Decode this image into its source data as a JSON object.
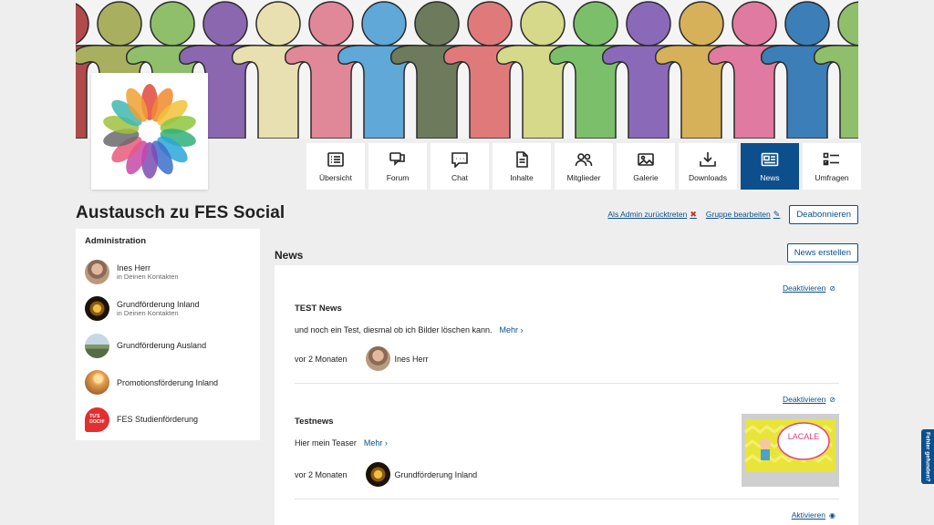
{
  "tabs": [
    {
      "label": "Übersicht",
      "icon": "list-icon"
    },
    {
      "label": "Forum",
      "icon": "chat-bubbles-icon"
    },
    {
      "label": "Chat",
      "icon": "chat-icon"
    },
    {
      "label": "Inhalte",
      "icon": "document-icon"
    },
    {
      "label": "Mitglieder",
      "icon": "members-icon"
    },
    {
      "label": "Galerie",
      "icon": "image-icon"
    },
    {
      "label": "Downloads",
      "icon": "download-icon"
    },
    {
      "label": "News",
      "icon": "news-icon",
      "active": true
    },
    {
      "label": "Umfragen",
      "icon": "poll-icon"
    }
  ],
  "group": {
    "title": "Austausch zu FES Social"
  },
  "actions": {
    "leave_admin": "Als Admin zurücktreten",
    "edit_group": "Gruppe bearbeiten",
    "unsubscribe": "Deabonnieren"
  },
  "sidebar": {
    "heading": "Administration",
    "members": [
      {
        "name": "Ines Herr",
        "sub": "in Deinen Kontakten"
      },
      {
        "name": "Grundförderung Inland",
        "sub": "in Deinen Kontakten"
      },
      {
        "name": "Grundförderung Ausland",
        "sub": ""
      },
      {
        "name": "Promotionsförderung Inland",
        "sub": ""
      },
      {
        "name": "FES Studienförderung",
        "sub": ""
      }
    ]
  },
  "news": {
    "heading": "News",
    "create_label": "News erstellen",
    "items": [
      {
        "toggle_label": "Deaktivieren",
        "title": "TEST News",
        "teaser": "und noch ein Test, diesmal ob ich Bilder löschen kann.",
        "more_label": "Mehr",
        "time": "vor 2 Monaten",
        "author": "Ines Herr"
      },
      {
        "toggle_label": "Deaktivieren",
        "title": "Testnews",
        "teaser": "Hier mein Teaser",
        "more_label": "Mehr",
        "time": "vor 2 Monaten",
        "author": "Grundförderung Inland",
        "thumbnail_text": "LACALE"
      },
      {
        "toggle_label": "Aktivieren"
      }
    ]
  },
  "feedback": {
    "label": "Fehler gefunden?"
  },
  "colors": {
    "primary": "#0c4f8c",
    "background": "#eeeeee",
    "danger": "#c0392b"
  }
}
